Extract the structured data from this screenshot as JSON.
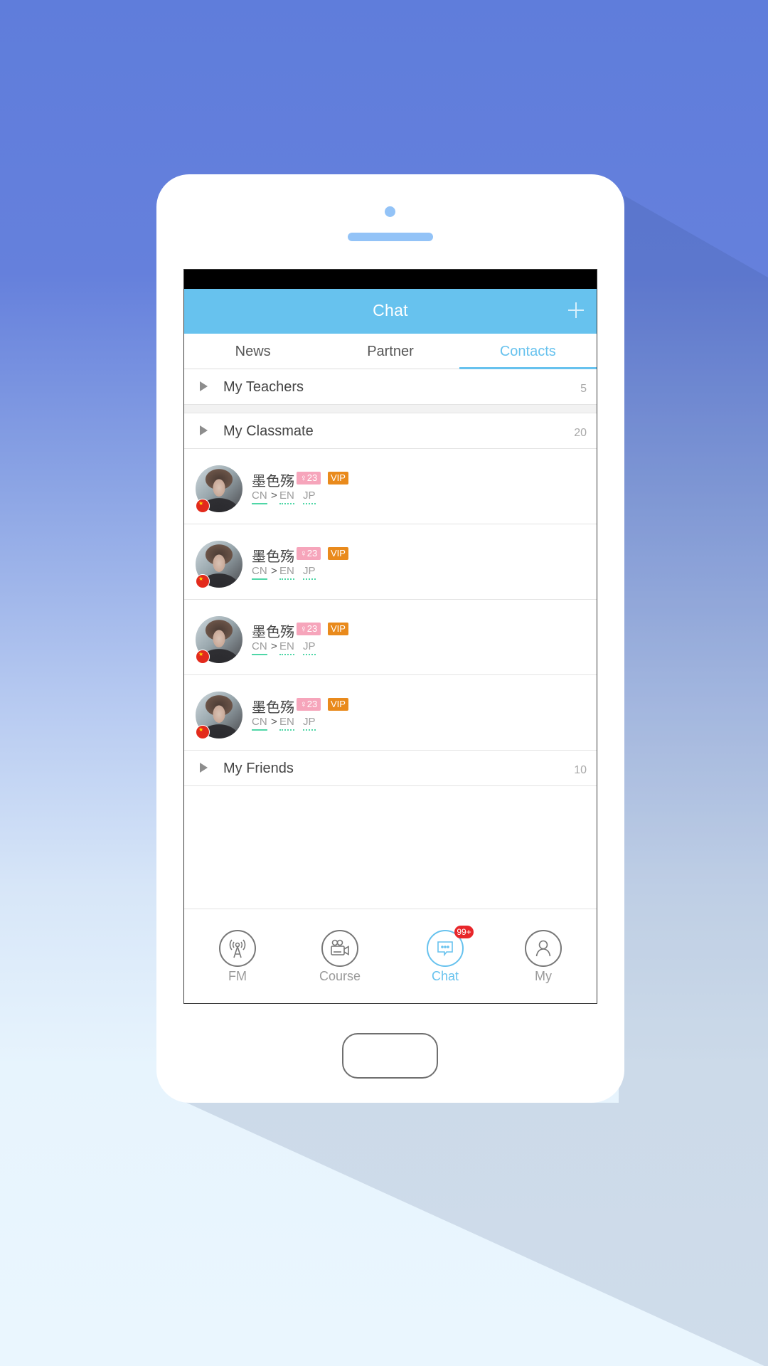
{
  "colors": {
    "accent": "#67c2ee",
    "vip": "#e98a1c",
    "age_badge": "#f6a5bb",
    "language_underline": "#4fd6a7",
    "notification_badge": "#e8262a"
  },
  "header": {
    "title": "Chat",
    "add_icon": "plus-icon"
  },
  "tabs": [
    {
      "label": "News",
      "active": false
    },
    {
      "label": "Partner",
      "active": false
    },
    {
      "label": "Contacts",
      "active": true
    }
  ],
  "groups": [
    {
      "label": "My Teachers",
      "count": "5",
      "expanded": false
    },
    {
      "label": "My Classmate",
      "count": "20",
      "expanded": true
    },
    {
      "label": "My Friends",
      "count": "10",
      "expanded": false
    }
  ],
  "contacts": [
    {
      "name": "墨色殇",
      "age_badge": "♀23",
      "vip_badge": "VIP",
      "flag": "china-flag-icon",
      "native": "CN",
      "arrow": ">",
      "learning": [
        "EN",
        "JP"
      ]
    },
    {
      "name": "墨色殇",
      "age_badge": "♀23",
      "vip_badge": "VIP",
      "flag": "china-flag-icon",
      "native": "CN",
      "arrow": ">",
      "learning": [
        "EN",
        "JP"
      ]
    },
    {
      "name": "墨色殇",
      "age_badge": "♀23",
      "vip_badge": "VIP",
      "flag": "china-flag-icon",
      "native": "CN",
      "arrow": ">",
      "learning": [
        "EN",
        "JP"
      ]
    },
    {
      "name": "墨色殇",
      "age_badge": "♀23",
      "vip_badge": "VIP",
      "flag": "china-flag-icon",
      "native": "CN",
      "arrow": ">",
      "learning": [
        "EN",
        "JP"
      ]
    }
  ],
  "bottom_nav": [
    {
      "label": "FM",
      "icon": "radio-tower-icon",
      "active": false
    },
    {
      "label": "Course",
      "icon": "video-camera-icon",
      "active": false
    },
    {
      "label": "Chat",
      "icon": "chat-bubble-icon",
      "active": true,
      "badge": "99+"
    },
    {
      "label": "My",
      "icon": "user-icon",
      "active": false
    }
  ]
}
